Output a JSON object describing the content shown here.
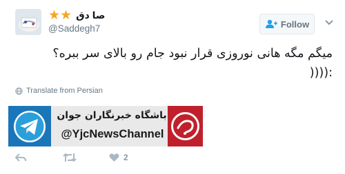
{
  "header": {
    "display_name": "صا دق",
    "stars": "★★",
    "handle": "@Saddegh7",
    "follow_label": "Follow",
    "avatar_icon": "avatar-photo",
    "follow_icon": "add-user-icon",
    "menu_icon": "chevron-down-icon"
  },
  "tweet": {
    "line1": "میگم مگه هانی نوروزی قرار نبود جام رو بالای سر ببره؟",
    "line2": ":((((",
    "translate_label": "Translate from Persian",
    "translate_icon": "globe-icon"
  },
  "media": {
    "title": "باشگاه خبرنگاران جوان",
    "handle": "@YjcNewsChannel",
    "left_icon": "telegram-icon",
    "right_icon": "yjc-logo-icon"
  },
  "actions": {
    "reply_icon": "reply-icon",
    "retweet_icon": "retweet-icon",
    "like_icon": "heart-icon",
    "like_count": "2"
  },
  "colors": {
    "star": "#f5a623",
    "handle_gray": "#657786",
    "telegram_blue": "#1b75b9",
    "yjc_red": "#c0202c",
    "action_gray": "#aab8c2"
  }
}
